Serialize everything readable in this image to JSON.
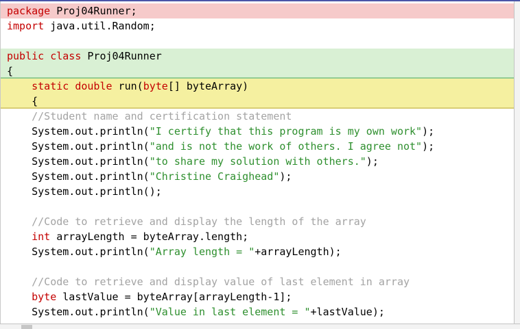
{
  "editor": {
    "language": "java",
    "colors": {
      "keyword": "#c40000",
      "string": "#2e8f2e",
      "comment": "#a3a3a3",
      "plain": "#000000",
      "highlight_package": "#f6caca",
      "highlight_class": "#d9f0d4",
      "highlight_method": "#f5f0a0"
    },
    "lines": [
      {
        "bg": "red",
        "edge": false,
        "segments": [
          {
            "c": "kw",
            "t": "package"
          },
          {
            "c": "pl",
            "t": " Proj04Runner;"
          }
        ]
      },
      {
        "bg": null,
        "edge": false,
        "segments": [
          {
            "c": "kw",
            "t": "import"
          },
          {
            "c": "pl",
            "t": " java.util.Random;"
          }
        ]
      },
      {
        "bg": null,
        "edge": false,
        "segments": []
      },
      {
        "bg": "green",
        "edge": false,
        "segments": [
          {
            "c": "kw",
            "t": "public"
          },
          {
            "c": "pl",
            "t": " "
          },
          {
            "c": "kw",
            "t": "class"
          },
          {
            "c": "pl",
            "t": " Proj04Runner"
          }
        ]
      },
      {
        "bg": "green",
        "edge": true,
        "segments": [
          {
            "c": "pl",
            "t": "{"
          }
        ]
      },
      {
        "bg": "yellow",
        "edge": false,
        "segments": [
          {
            "c": "pl",
            "t": "    "
          },
          {
            "c": "kw",
            "t": "static"
          },
          {
            "c": "pl",
            "t": " "
          },
          {
            "c": "kw",
            "t": "double"
          },
          {
            "c": "pl",
            "t": " run("
          },
          {
            "c": "kw",
            "t": "byte"
          },
          {
            "c": "pl",
            "t": "[] byteArray)"
          }
        ]
      },
      {
        "bg": "yellow",
        "edge": true,
        "segments": [
          {
            "c": "pl",
            "t": "    {"
          }
        ]
      },
      {
        "bg": null,
        "edge": false,
        "segments": [
          {
            "c": "cm",
            "t": "    //Student name and certification statement"
          }
        ]
      },
      {
        "bg": null,
        "edge": false,
        "segments": [
          {
            "c": "pl",
            "t": "    System.out.println("
          },
          {
            "c": "st",
            "t": "\"I certify that this program is my own work\""
          },
          {
            "c": "pl",
            "t": ");"
          }
        ]
      },
      {
        "bg": null,
        "edge": false,
        "segments": [
          {
            "c": "pl",
            "t": "    System.out.println("
          },
          {
            "c": "st",
            "t": "\"and is not the work of others. I agree not\""
          },
          {
            "c": "pl",
            "t": ");"
          }
        ]
      },
      {
        "bg": null,
        "edge": false,
        "segments": [
          {
            "c": "pl",
            "t": "    System.out.println("
          },
          {
            "c": "st",
            "t": "\"to share my solution with others.\""
          },
          {
            "c": "pl",
            "t": ");"
          }
        ]
      },
      {
        "bg": null,
        "edge": false,
        "segments": [
          {
            "c": "pl",
            "t": "    System.out.println("
          },
          {
            "c": "st",
            "t": "\"Christine Craighead\""
          },
          {
            "c": "pl",
            "t": ");"
          }
        ]
      },
      {
        "bg": null,
        "edge": false,
        "segments": [
          {
            "c": "pl",
            "t": "    System.out.println();"
          }
        ]
      },
      {
        "bg": null,
        "edge": false,
        "segments": []
      },
      {
        "bg": null,
        "edge": false,
        "segments": [
          {
            "c": "cm",
            "t": "    //Code to retrieve and display the length of the array"
          }
        ]
      },
      {
        "bg": null,
        "edge": false,
        "segments": [
          {
            "c": "pl",
            "t": "    "
          },
          {
            "c": "kw",
            "t": "int"
          },
          {
            "c": "pl",
            "t": " arrayLength = byteArray.length;"
          }
        ]
      },
      {
        "bg": null,
        "edge": false,
        "segments": [
          {
            "c": "pl",
            "t": "    System.out.println("
          },
          {
            "c": "st",
            "t": "\"Array length = \""
          },
          {
            "c": "pl",
            "t": "+arrayLength);"
          }
        ]
      },
      {
        "bg": null,
        "edge": false,
        "segments": []
      },
      {
        "bg": null,
        "edge": false,
        "segments": [
          {
            "c": "cm",
            "t": "    //Code to retrieve and display value of last element in array"
          }
        ]
      },
      {
        "bg": null,
        "edge": false,
        "segments": [
          {
            "c": "pl",
            "t": "    "
          },
          {
            "c": "kw",
            "t": "byte"
          },
          {
            "c": "pl",
            "t": " lastValue = byteArray[arrayLength-1];"
          }
        ]
      },
      {
        "bg": null,
        "edge": false,
        "segments": [
          {
            "c": "pl",
            "t": "    System.out.println("
          },
          {
            "c": "st",
            "t": "\"Value in last element = \""
          },
          {
            "c": "pl",
            "t": "+lastValue);"
          }
        ]
      }
    ]
  }
}
